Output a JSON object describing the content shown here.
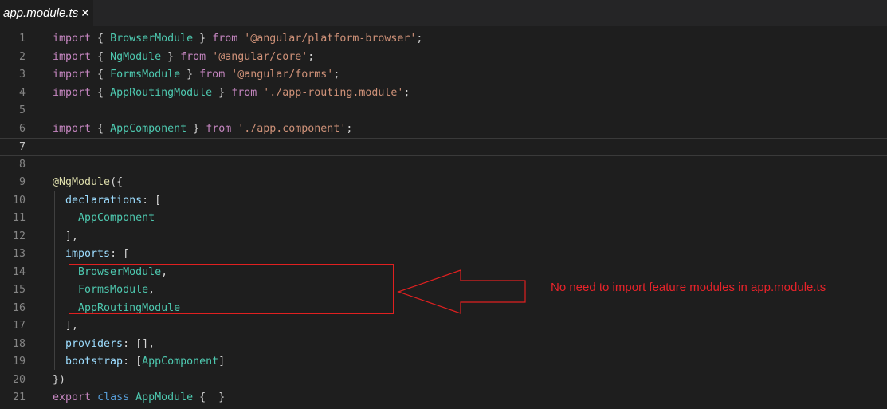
{
  "tab": {
    "title": "app.module.ts",
    "close_glyph": "✕"
  },
  "lines": [
    {
      "n": "1",
      "tokens": [
        [
          "k",
          "import"
        ],
        [
          "p",
          " { "
        ],
        [
          "t",
          "BrowserModule"
        ],
        [
          "p",
          " } "
        ],
        [
          "k",
          "from"
        ],
        [
          "p",
          " "
        ],
        [
          "s",
          "'@angular/platform-browser'"
        ],
        [
          "p",
          ";"
        ]
      ]
    },
    {
      "n": "2",
      "tokens": [
        [
          "k",
          "import"
        ],
        [
          "p",
          " { "
        ],
        [
          "t",
          "NgModule"
        ],
        [
          "p",
          " } "
        ],
        [
          "k",
          "from"
        ],
        [
          "p",
          " "
        ],
        [
          "s",
          "'@angular/core'"
        ],
        [
          "p",
          ";"
        ]
      ]
    },
    {
      "n": "3",
      "tokens": [
        [
          "k",
          "import"
        ],
        [
          "p",
          " { "
        ],
        [
          "t",
          "FormsModule"
        ],
        [
          "p",
          " } "
        ],
        [
          "k",
          "from"
        ],
        [
          "p",
          " "
        ],
        [
          "s",
          "'@angular/forms'"
        ],
        [
          "p",
          ";"
        ]
      ]
    },
    {
      "n": "4",
      "tokens": [
        [
          "k",
          "import"
        ],
        [
          "p",
          " { "
        ],
        [
          "t",
          "AppRoutingModule"
        ],
        [
          "p",
          " } "
        ],
        [
          "k",
          "from"
        ],
        [
          "p",
          " "
        ],
        [
          "s",
          "'./app-routing.module'"
        ],
        [
          "p",
          ";"
        ]
      ]
    },
    {
      "n": "5",
      "tokens": []
    },
    {
      "n": "6",
      "tokens": [
        [
          "k",
          "import"
        ],
        [
          "p",
          " { "
        ],
        [
          "t",
          "AppComponent"
        ],
        [
          "p",
          " } "
        ],
        [
          "k",
          "from"
        ],
        [
          "p",
          " "
        ],
        [
          "s",
          "'./app.component'"
        ],
        [
          "p",
          ";"
        ]
      ]
    },
    {
      "n": "7",
      "tokens": [],
      "current": true
    },
    {
      "n": "8",
      "tokens": []
    },
    {
      "n": "9",
      "tokens": [
        [
          "dec",
          "@NgModule"
        ],
        [
          "p",
          "({"
        ]
      ]
    },
    {
      "n": "10",
      "tokens": [
        [
          "p",
          "  "
        ],
        [
          "prop",
          "declarations"
        ],
        [
          "p",
          ": ["
        ]
      ]
    },
    {
      "n": "11",
      "tokens": [
        [
          "p",
          "    "
        ],
        [
          "t",
          "AppComponent"
        ]
      ]
    },
    {
      "n": "12",
      "tokens": [
        [
          "p",
          "  ],"
        ]
      ]
    },
    {
      "n": "13",
      "tokens": [
        [
          "p",
          "  "
        ],
        [
          "prop",
          "imports"
        ],
        [
          "p",
          ": ["
        ]
      ]
    },
    {
      "n": "14",
      "tokens": [
        [
          "p",
          "    "
        ],
        [
          "t",
          "BrowserModule"
        ],
        [
          "p",
          ","
        ]
      ]
    },
    {
      "n": "15",
      "tokens": [
        [
          "p",
          "    "
        ],
        [
          "t",
          "FormsModule"
        ],
        [
          "p",
          ","
        ]
      ]
    },
    {
      "n": "16",
      "tokens": [
        [
          "p",
          "    "
        ],
        [
          "t",
          "AppRoutingModule"
        ]
      ]
    },
    {
      "n": "17",
      "tokens": [
        [
          "p",
          "  ],"
        ]
      ]
    },
    {
      "n": "18",
      "tokens": [
        [
          "p",
          "  "
        ],
        [
          "prop",
          "providers"
        ],
        [
          "p",
          ": [],"
        ]
      ]
    },
    {
      "n": "19",
      "tokens": [
        [
          "p",
          "  "
        ],
        [
          "prop",
          "bootstrap"
        ],
        [
          "p",
          ": ["
        ],
        [
          "t",
          "AppComponent"
        ],
        [
          "p",
          "]"
        ]
      ]
    },
    {
      "n": "20",
      "tokens": [
        [
          "p",
          "})"
        ]
      ]
    },
    {
      "n": "21",
      "tokens": [
        [
          "k",
          "export"
        ],
        [
          "p",
          " "
        ],
        [
          "kb",
          "class"
        ],
        [
          "p",
          " "
        ],
        [
          "t",
          "AppModule"
        ],
        [
          "p",
          " {  }"
        ]
      ]
    }
  ],
  "annotation": {
    "note": "No need to import feature modules in app.module.ts",
    "color": "#e8232a"
  }
}
